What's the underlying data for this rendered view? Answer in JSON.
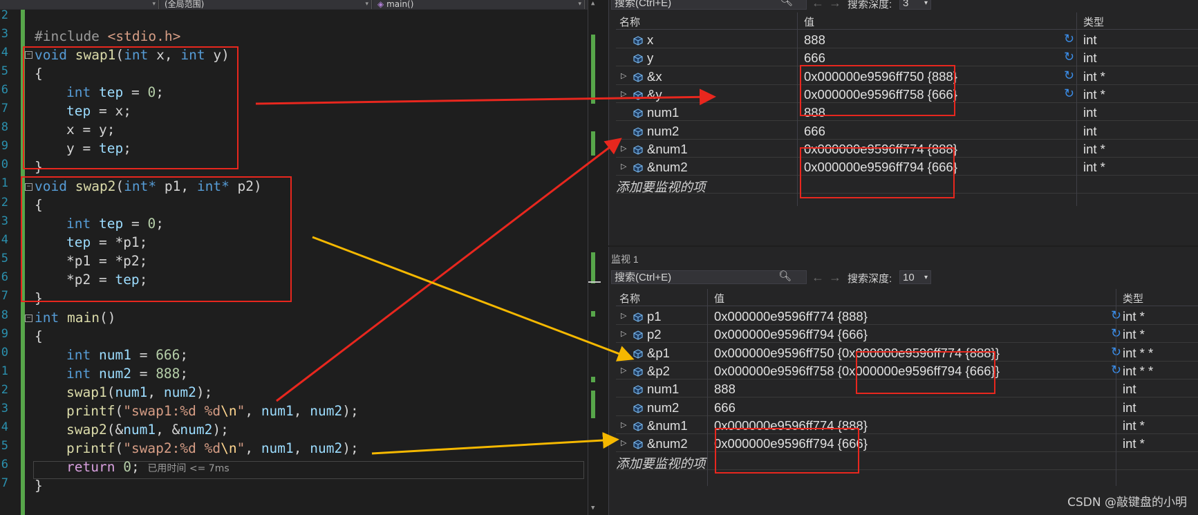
{
  "editor": {
    "nav": {
      "scope": "(全局范围)",
      "member": "main()"
    },
    "line_numbers": [
      "2",
      "3",
      "4",
      "5",
      "6",
      "7",
      "8",
      "9",
      "0",
      "1",
      "2",
      "3",
      "4",
      "5",
      "6",
      "7",
      "8",
      "9",
      "0",
      "1",
      "2",
      "3",
      "4",
      "5",
      "6",
      "7"
    ],
    "code": {
      "include_dir": "#include",
      "include_file": "<stdio.h>",
      "swap1_sig": [
        "void",
        "swap1",
        "(",
        "int",
        " x, ",
        "int",
        " y)"
      ],
      "brace_open": "{",
      "brace_close": "}",
      "kw_int": "int",
      "kw_void": "void",
      "kw_return": "return",
      "tep": "tep",
      "zero": "0",
      "swap1_body": [
        "int tep = 0;",
        "tep = x;",
        "x = y;",
        "y = tep;"
      ],
      "swap2_name": "swap2",
      "swap2_params": [
        "(",
        "int*",
        " p1, ",
        "int*",
        " p2)"
      ],
      "swap2_body": [
        "int tep = 0;",
        "tep = *p1;",
        "*p1 = *p2;",
        "*p2 = tep;"
      ],
      "main_name": "main",
      "main_parens": "()",
      "num1": "num1",
      "num2": "num2",
      "val666": "666",
      "val888": "888",
      "call_swap1": "swap1",
      "call_swap2": "swap2",
      "printf": "printf",
      "fmt_swap1": "\"swap1:%d %d",
      "fmt_swap2": "\"swap2:%d %d",
      "esc_n": "\\n",
      "quote_close": "\"",
      "elapsed_hint": "已用时间 <= 7ms"
    }
  },
  "watch_top": {
    "search_placeholder": "搜索(Ctrl+E)",
    "depth_label": "搜索深度:",
    "depth_value": "3",
    "columns": [
      "名称",
      "值",
      "类型"
    ],
    "rows": [
      {
        "name": "x",
        "value": "888",
        "type": "int",
        "expandable": false,
        "refresh": true
      },
      {
        "name": "y",
        "value": "666",
        "type": "int",
        "expandable": false,
        "refresh": true
      },
      {
        "name": "&x",
        "value": "0x000000e9596ff750 {888}",
        "type": "int *",
        "expandable": true,
        "refresh": true
      },
      {
        "name": "&y",
        "value": "0x000000e9596ff758 {666}",
        "type": "int *",
        "expandable": true,
        "refresh": true
      },
      {
        "name": "num1",
        "value": "888",
        "type": "int",
        "expandable": false,
        "refresh": false
      },
      {
        "name": "num2",
        "value": "666",
        "type": "int",
        "expandable": false,
        "refresh": false
      },
      {
        "name": "&num1",
        "value": "0x000000e9596ff774 {888}",
        "type": "int *",
        "expandable": true,
        "refresh": false
      },
      {
        "name": "&num2",
        "value": "0x000000e9596ff794 {666}",
        "type": "int *",
        "expandable": true,
        "refresh": false
      }
    ],
    "add_item": "添加要监视的项"
  },
  "watch_bottom": {
    "title": "监视 1",
    "search_placeholder": "搜索(Ctrl+E)",
    "depth_label": "搜索深度:",
    "depth_value": "10",
    "columns": [
      "名称",
      "值",
      "类型"
    ],
    "rows": [
      {
        "name": "p1",
        "value": "0x000000e9596ff774 {888}",
        "type": "int *",
        "expandable": true,
        "refresh": true
      },
      {
        "name": "p2",
        "value": "0x000000e9596ff794 {666}",
        "type": "int *",
        "expandable": true,
        "refresh": true
      },
      {
        "name": "&p1",
        "value": "0x000000e9596ff750 {0x000000e9596ff774 {888}}",
        "type": "int * *",
        "expandable": true,
        "refresh": true
      },
      {
        "name": "&p2",
        "value": "0x000000e9596ff758 {0x000000e9596ff794 {666}}",
        "type": "int * *",
        "expandable": true,
        "refresh": true
      },
      {
        "name": "num1",
        "value": "888",
        "type": "int",
        "expandable": false,
        "refresh": false
      },
      {
        "name": "num2",
        "value": "666",
        "type": "int",
        "expandable": false,
        "refresh": false
      },
      {
        "name": "&num1",
        "value": "0x000000e9596ff774 {888}",
        "type": "int *",
        "expandable": true,
        "refresh": false
      },
      {
        "name": "&num2",
        "value": "0x000000e9596ff794 {666}",
        "type": "int *",
        "expandable": true,
        "refresh": false
      }
    ],
    "add_item": "添加要监视的项"
  },
  "colors": {
    "annotation_red": "#e8271e",
    "annotation_yellow": "#f5b800",
    "editor_bg": "#1e1e1e",
    "panel_bg": "#252526"
  },
  "watermark": "CSDN @敲键盘的小明"
}
